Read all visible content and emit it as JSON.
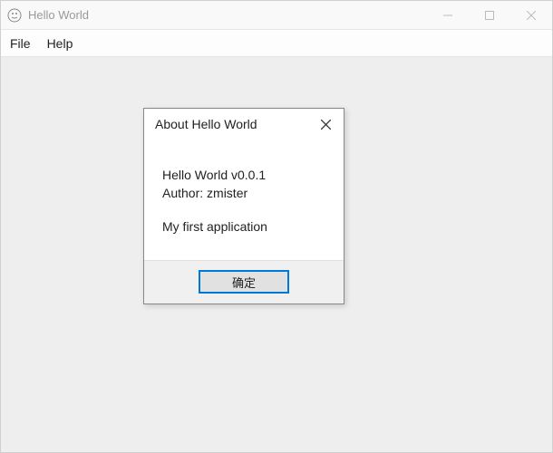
{
  "window": {
    "title": "Hello World"
  },
  "menubar": {
    "items": [
      "File",
      "Help"
    ]
  },
  "dialog": {
    "title": "About Hello World",
    "line1": "Hello World v0.0.1",
    "line2": "Author: zmister",
    "line3": "My first application",
    "ok_label": "确定"
  }
}
